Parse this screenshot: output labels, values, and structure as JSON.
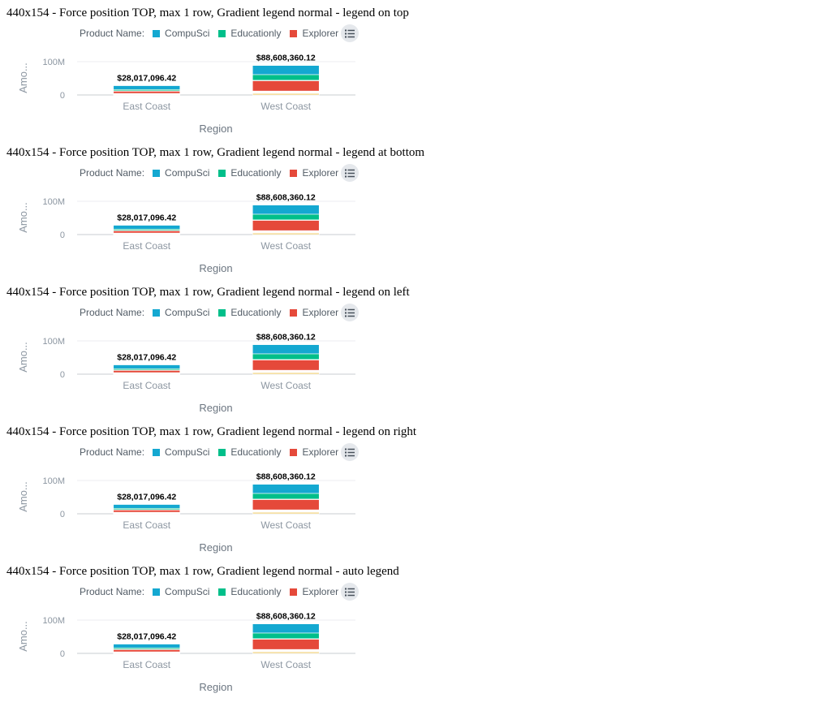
{
  "blocks": [
    {
      "title": "440x154 - Force position TOP, max 1 row, Gradient legend normal - legend on top"
    },
    {
      "title": "440x154 - Force position TOP, max 1 row, Gradient legend normal - legend at bottom"
    },
    {
      "title": "440x154 - Force position TOP, max 1 row, Gradient legend normal - legend on left"
    },
    {
      "title": "440x154 - Force position TOP, max 1 row, Gradient legend normal - legend on right"
    },
    {
      "title": "440x154 - Force position TOP, max 1 row, Gradient legend normal - auto legend"
    }
  ],
  "legend": {
    "title": "Product Name:",
    "items": [
      {
        "label": "CompuSci",
        "color": "#14a8d1"
      },
      {
        "label": "Educationly",
        "color": "#00bf8a"
      },
      {
        "label": "Explorer",
        "color": "#e5493a"
      }
    ],
    "menu_icon": "list-icon"
  },
  "chart_data": {
    "type": "bar",
    "stacked": true,
    "xlabel": "Region",
    "ylabel": "Amo...",
    "categories": [
      "East Coast",
      "West Coast"
    ],
    "yticks": [
      {
        "value": 0,
        "label": "0"
      },
      {
        "value": 100000000,
        "label": "100M"
      }
    ],
    "ylim": [
      0,
      100000000
    ],
    "totals": [
      28017096.42,
      88608360.12
    ],
    "total_labels": [
      "$28,017,096.42",
      "$88,608,360.12"
    ],
    "series": [
      {
        "color": "#f2d27d",
        "values": [
          0,
          4500000
        ]
      },
      {
        "color": "#c8a165",
        "values": [
          900000,
          1600000
        ]
      },
      {
        "color": "#e4c48c",
        "values": [
          900000,
          1300000
        ]
      },
      {
        "color": "#9e3d4f",
        "values": [
          900000,
          1300000
        ]
      },
      {
        "color": "#e07d3a",
        "values": [
          900000,
          1500000
        ]
      },
      {
        "color": "#d9c3b0",
        "values": [
          1100000,
          1600000
        ]
      },
      {
        "color": "#e5493a",
        "values": [
          7000000,
          31000000
        ]
      },
      {
        "color": "#d9c3b0",
        "values": [
          700000,
          1400000
        ]
      },
      {
        "color": "#00bf8a",
        "values": [
          4000000,
          17000000
        ]
      },
      {
        "color": "#14a8d1",
        "values": [
          11517096.42,
          27408360.12
        ]
      }
    ],
    "grid": true,
    "legend_position": "top"
  }
}
